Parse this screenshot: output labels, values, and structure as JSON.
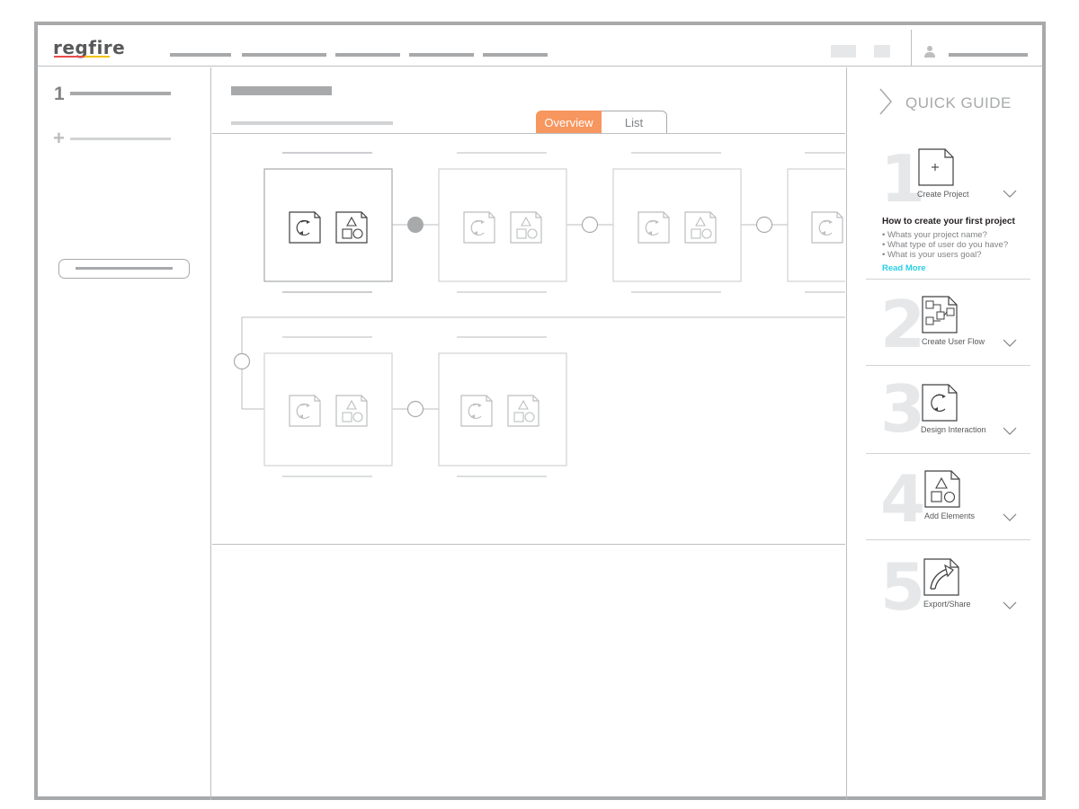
{
  "header": {
    "logo": "regfire"
  },
  "main": {
    "tabs": [
      {
        "label": "Overview",
        "active": true
      },
      {
        "label": "List",
        "active": false
      }
    ]
  },
  "quick_guide": {
    "title": "QUICK GUIDE",
    "steps": [
      {
        "number": "1",
        "label": "Create Project",
        "icon": "new-file-icon",
        "expanded": true,
        "heading": "How to create your first project",
        "bullets": [
          "• Whats your project name?",
          "• What type of user do you have?",
          "• What is your users goal?"
        ],
        "link": "Read More"
      },
      {
        "number": "2",
        "label": "Create User Flow",
        "icon": "flow-file-icon",
        "expanded": false
      },
      {
        "number": "3",
        "label": "Design Interaction",
        "icon": "interaction-file-icon",
        "expanded": false
      },
      {
        "number": "4",
        "label": "Add Elements",
        "icon": "elements-file-icon",
        "expanded": false
      },
      {
        "number": "5",
        "label": "Export/Share",
        "icon": "export-share-icon",
        "expanded": false
      }
    ]
  },
  "colors": {
    "accent": "#f7965e",
    "link": "#27d0e3",
    "frame": "#a7a9ab",
    "line": "#bcbec0"
  }
}
